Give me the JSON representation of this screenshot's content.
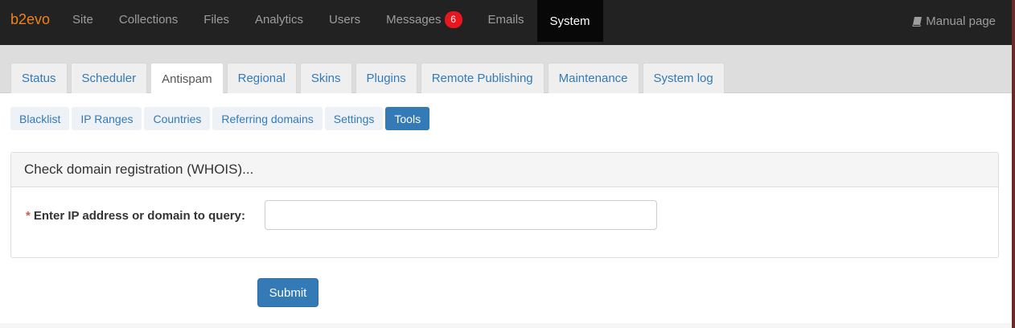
{
  "navbar": {
    "brand": "b2evo",
    "items": [
      {
        "label": "Site"
      },
      {
        "label": "Collections"
      },
      {
        "label": "Files"
      },
      {
        "label": "Analytics"
      },
      {
        "label": "Users"
      },
      {
        "label": "Messages",
        "badge": "6"
      },
      {
        "label": "Emails"
      },
      {
        "label": "System",
        "active": true
      }
    ],
    "manual": "Manual page"
  },
  "tabs": [
    {
      "label": "Status"
    },
    {
      "label": "Scheduler"
    },
    {
      "label": "Antispam",
      "active": true
    },
    {
      "label": "Regional"
    },
    {
      "label": "Skins"
    },
    {
      "label": "Plugins"
    },
    {
      "label": "Remote Publishing"
    },
    {
      "label": "Maintenance"
    },
    {
      "label": "System log"
    }
  ],
  "subtabs": [
    {
      "label": "Blacklist"
    },
    {
      "label": "IP Ranges"
    },
    {
      "label": "Countries"
    },
    {
      "label": "Referring domains"
    },
    {
      "label": "Settings"
    },
    {
      "label": "Tools",
      "active": true
    }
  ],
  "panel": {
    "title": "Check domain registration (WHOIS)...",
    "required_mark": "*",
    "field_label": "Enter IP address or domain to query:",
    "field_value": ""
  },
  "submit_label": "Submit",
  "colors": {
    "brand": "#f0821e",
    "navbar_bg": "#222222",
    "link": "#337ab7",
    "badge": "#e8171f"
  }
}
